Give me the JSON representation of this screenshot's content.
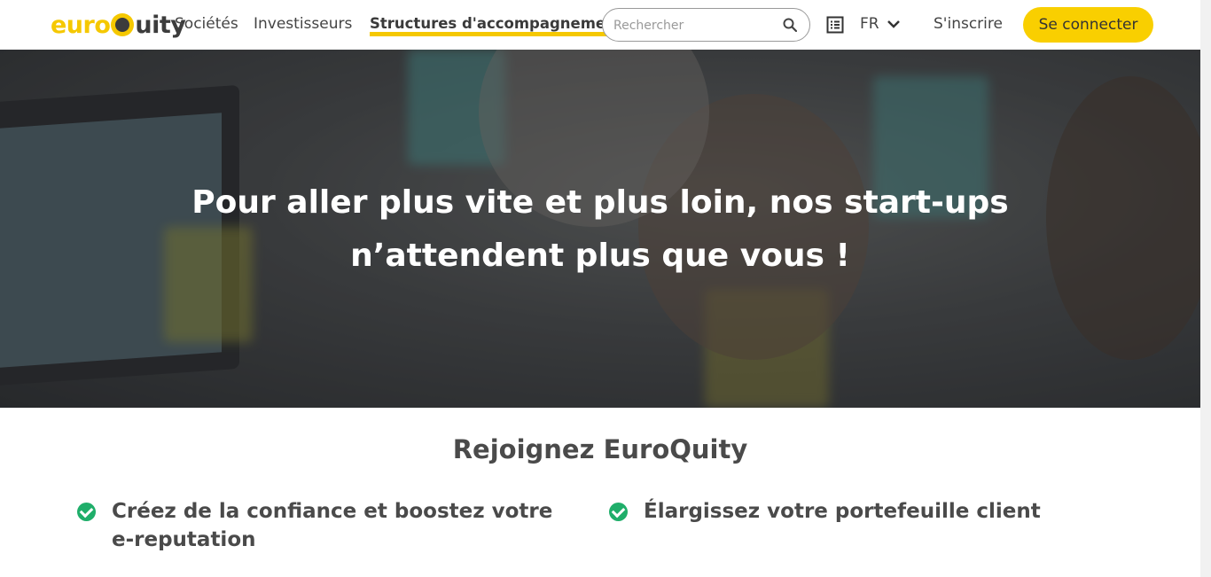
{
  "brand": {
    "logo_part1": "euro",
    "logo_part2": "uity"
  },
  "nav": {
    "items": [
      {
        "label": "Sociétés"
      },
      {
        "label": "Investisseurs"
      },
      {
        "label": "Structures d'accompagnement",
        "active": true
      }
    ]
  },
  "search": {
    "placeholder": "Rechercher",
    "icon": "search-icon"
  },
  "header": {
    "list_icon": "list-icon",
    "language": "FR",
    "signup_label": "S'inscrire",
    "login_label": "Se connecter"
  },
  "hero": {
    "title": "Pour aller plus vite et plus loin, nos start-ups n’attendent plus que vous !"
  },
  "join": {
    "title": "Rejoignez EuroQuity",
    "benefits": [
      {
        "text": "Créez de la confiance et boostez votre e-reputation"
      },
      {
        "text": "Élargissez votre portefeuille client"
      }
    ]
  },
  "colors": {
    "accent": "#f9cf00",
    "check": "#1fae6a",
    "text": "#4a4a4a"
  }
}
